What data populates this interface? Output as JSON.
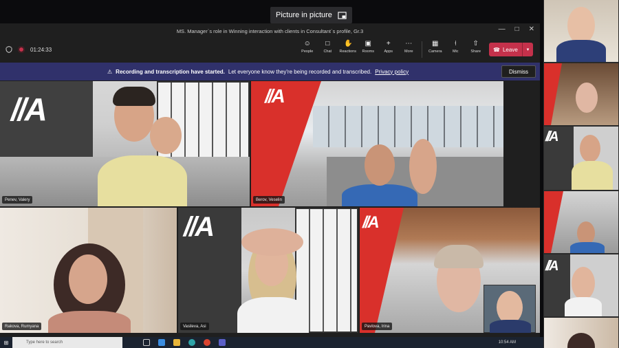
{
  "pip": {
    "label": "Picture in picture"
  },
  "window": {
    "title": "MS. Manager`s role in Winning interaction with clients in Consultant`s profile, Gr.3",
    "controls": [
      "—",
      "□",
      "✕"
    ]
  },
  "toolbar": {
    "timer": "01:24:33",
    "actions": [
      {
        "label": "People",
        "icon": "people-icon"
      },
      {
        "label": "Chat",
        "icon": "chat-icon"
      },
      {
        "label": "Reactions",
        "icon": "reactions-icon"
      },
      {
        "label": "Rooms",
        "icon": "rooms-icon"
      },
      {
        "label": "Apps",
        "icon": "apps-icon"
      },
      {
        "label": "More",
        "icon": "more-icon"
      },
      {
        "label": "Camera",
        "icon": "camera-icon"
      },
      {
        "label": "Mic",
        "icon": "mic-icon"
      },
      {
        "label": "Share",
        "icon": "share-icon"
      }
    ],
    "leave_label": "Leave"
  },
  "banner": {
    "bold": "Recording and transcription have started.",
    "text": "Let everyone know they're being recorded and transcribed.",
    "link": "Privacy policy",
    "dismiss": "Dismiss"
  },
  "logo_text": "//A",
  "participants": [
    {
      "name": "Penev, Valery"
    },
    {
      "name": "Berov, Veselin"
    },
    {
      "name": "Rakova, Rumyana"
    },
    {
      "name": "Vasileva, Asi"
    },
    {
      "name": "Pavlova, Irina"
    }
  ],
  "taskbar": {
    "search_placeholder": "Type here to search",
    "time": "10:54 AM"
  },
  "colors": {
    "banner": "#30316b",
    "leave": "#c4314b",
    "brand_red": "#d9302b"
  }
}
